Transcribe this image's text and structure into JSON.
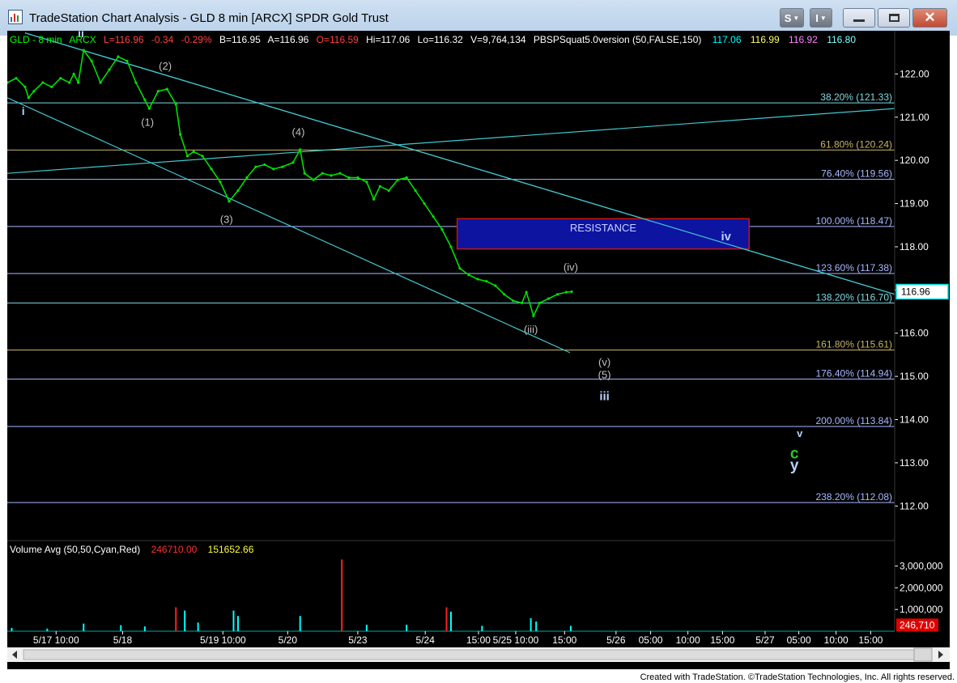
{
  "window": {
    "title": "TradeStation Chart Analysis - GLD 8 min [ARCX] SPDR Gold Trust",
    "btn_s": "S",
    "btn_i": "I",
    "footer": "Created with TradeStation. ©TradeStation Technologies, Inc. All rights reserved."
  },
  "colors": {
    "background": "#000000",
    "price": "#00e000",
    "channel": "#40c8d0",
    "fib_cyan": "#7fd8e0",
    "fib_olive": "#c8b46a",
    "fib_blue": "#a9b8ff",
    "resistance_fill": "#0d14a0",
    "resistance_border": "#c01616",
    "label_wave": "#c0c0c0",
    "label_green": "#22cc22",
    "label_blue": "#b8d0ff",
    "volume_cyan": "#00ffff",
    "volume_red": "#ff2020"
  },
  "header": {
    "symbol": "GLD - 8 min",
    "exchange": "ARCX",
    "last": "L=116.96",
    "change": "-0.34",
    "change_pct": "-0.29%",
    "bid": "B=116.95",
    "ask": "A=116.96",
    "open": "O=116.59",
    "high": "Hi=117.06",
    "low": "Lo=116.32",
    "volume": "V=9,764,134",
    "indicator": "PBSPSquat5.0version (50,FALSE,150)",
    "ind_v1": "117.06",
    "ind_v2": "116.99",
    "ind_v3": "116.92",
    "ind_v4": "116.80"
  },
  "volume_header": {
    "label": "Volume Avg (50,50,Cyan,Red)",
    "v1": "246710.00",
    "v2": "151652.66"
  },
  "resistance_label": "RESISTANCE",
  "chart_data": {
    "type": "line",
    "symbol": "GLD",
    "interval": "8 min",
    "price_axis": {
      "range": [
        111.2,
        123.0
      ],
      "ticks": [
        "122.00",
        "121.00",
        "120.00",
        "119.00",
        "118.00",
        "117.00",
        "116.00",
        "115.00",
        "114.00",
        "113.00",
        "112.00"
      ],
      "tick_values": [
        122,
        121,
        120,
        119,
        118,
        117,
        116,
        115,
        114,
        113,
        112
      ],
      "last_price_label": "116.96",
      "last_price": 116.96
    },
    "volume_axis": {
      "range": [
        0,
        3500000
      ],
      "ticks": [
        "3,000,000",
        "2,000,000",
        "1,000,000"
      ],
      "tick_values": [
        3000000,
        2000000,
        1000000
      ],
      "last_label": "246,710",
      "last_value": 246710
    },
    "time_axis": {
      "range": [
        0,
        100
      ],
      "labels": [
        {
          "t": 5.5,
          "text": "5/17 10:00"
        },
        {
          "t": 13.0,
          "text": "5/18"
        },
        {
          "t": 24.3,
          "text": "5/19 10:00"
        },
        {
          "t": 31.6,
          "text": "5/20"
        },
        {
          "t": 39.5,
          "text": "5/23"
        },
        {
          "t": 47.1,
          "text": "5/24"
        },
        {
          "t": 53.1,
          "text": "15:00"
        },
        {
          "t": 57.3,
          "text": "5/25 10:00"
        },
        {
          "t": 62.8,
          "text": "15:00"
        },
        {
          "t": 68.6,
          "text": "5/26"
        },
        {
          "t": 72.5,
          "text": "05:00"
        },
        {
          "t": 76.7,
          "text": "10:00"
        },
        {
          "t": 80.6,
          "text": "15:00"
        },
        {
          "t": 85.4,
          "text": "5/27"
        },
        {
          "t": 89.2,
          "text": "05:00"
        },
        {
          "t": 93.4,
          "text": "10:00"
        },
        {
          "t": 97.3,
          "text": "15:00"
        }
      ]
    },
    "fib_levels": [
      {
        "label": "38.20% (121.33)",
        "value": 121.33,
        "color": "#7fd8e0"
      },
      {
        "label": "61.80% (120.24)",
        "value": 120.24,
        "color": "#c8b46a"
      },
      {
        "label": "76.40% (119.56)",
        "value": 119.56,
        "color": "#a9b8ff"
      },
      {
        "label": "100.00% (118.47)",
        "value": 118.47,
        "color": "#a9b8ff"
      },
      {
        "label": "123.60% (117.38)",
        "value": 117.38,
        "color": "#a9b8ff"
      },
      {
        "label": "138.20% (116.70)",
        "value": 116.7,
        "color": "#7fd8e0"
      },
      {
        "label": "161.80% (115.61)",
        "value": 115.61,
        "color": "#c8b46a"
      },
      {
        "label": "176.40% (114.94)",
        "value": 114.94,
        "color": "#a9b8ff"
      },
      {
        "label": "200.00% (113.84)",
        "value": 113.84,
        "color": "#a9b8ff"
      },
      {
        "label": "238.20% (112.08)",
        "value": 112.08,
        "color": "#a9b8ff"
      }
    ],
    "trendlines": [
      {
        "from": [
          2.0,
          122.95
        ],
        "to": [
          100.0,
          116.9
        ]
      },
      {
        "from": [
          0.0,
          121.45
        ],
        "to": [
          63.4,
          115.55
        ]
      },
      {
        "from": [
          0.0,
          119.7
        ],
        "to": [
          100.0,
          121.2
        ]
      }
    ],
    "resistance_box": {
      "t_range": [
        50.7,
        83.6
      ],
      "price_range": [
        117.95,
        118.65
      ]
    },
    "price_series": [
      {
        "t": 0.0,
        "v": 121.8
      },
      {
        "t": 1.0,
        "v": 121.9
      },
      {
        "t": 2.0,
        "v": 121.7
      },
      {
        "t": 2.4,
        "v": 121.45
      },
      {
        "t": 3.0,
        "v": 121.6
      },
      {
        "t": 4.0,
        "v": 121.8
      },
      {
        "t": 5.0,
        "v": 121.7
      },
      {
        "t": 6.0,
        "v": 121.9
      },
      {
        "t": 7.0,
        "v": 121.8
      },
      {
        "t": 7.5,
        "v": 122.0
      },
      {
        "t": 8.0,
        "v": 121.8
      },
      {
        "t": 8.6,
        "v": 122.55
      },
      {
        "t": 9.5,
        "v": 122.3
      },
      {
        "t": 10.5,
        "v": 121.8
      },
      {
        "t": 11.5,
        "v": 122.1
      },
      {
        "t": 12.5,
        "v": 122.4
      },
      {
        "t": 13.5,
        "v": 122.3
      },
      {
        "t": 14.5,
        "v": 121.8
      },
      {
        "t": 15.5,
        "v": 121.4
      },
      {
        "t": 16.0,
        "v": 121.2
      },
      {
        "t": 17.0,
        "v": 121.6
      },
      {
        "t": 18.0,
        "v": 121.65
      },
      {
        "t": 19.0,
        "v": 121.3
      },
      {
        "t": 19.5,
        "v": 120.6
      },
      {
        "t": 20.3,
        "v": 120.1
      },
      {
        "t": 21.0,
        "v": 120.2
      },
      {
        "t": 22.0,
        "v": 120.1
      },
      {
        "t": 23.0,
        "v": 119.8
      },
      {
        "t": 24.0,
        "v": 119.5
      },
      {
        "t": 25.0,
        "v": 119.05
      },
      {
        "t": 26.0,
        "v": 119.3
      },
      {
        "t": 27.0,
        "v": 119.6
      },
      {
        "t": 28.0,
        "v": 119.85
      },
      {
        "t": 29.0,
        "v": 119.9
      },
      {
        "t": 30.0,
        "v": 119.8
      },
      {
        "t": 31.0,
        "v": 119.85
      },
      {
        "t": 32.2,
        "v": 119.95
      },
      {
        "t": 33.0,
        "v": 120.25
      },
      {
        "t": 33.5,
        "v": 119.7
      },
      {
        "t": 34.5,
        "v": 119.55
      },
      {
        "t": 35.5,
        "v": 119.7
      },
      {
        "t": 36.5,
        "v": 119.65
      },
      {
        "t": 37.5,
        "v": 119.7
      },
      {
        "t": 38.5,
        "v": 119.6
      },
      {
        "t": 39.5,
        "v": 119.6
      },
      {
        "t": 40.5,
        "v": 119.5
      },
      {
        "t": 41.3,
        "v": 119.1
      },
      {
        "t": 42.0,
        "v": 119.4
      },
      {
        "t": 43.0,
        "v": 119.3
      },
      {
        "t": 44.0,
        "v": 119.55
      },
      {
        "t": 45.0,
        "v": 119.6
      },
      {
        "t": 46.0,
        "v": 119.3
      },
      {
        "t": 47.0,
        "v": 119.0
      },
      {
        "t": 48.0,
        "v": 118.7
      },
      {
        "t": 49.0,
        "v": 118.4
      },
      {
        "t": 50.0,
        "v": 118.0
      },
      {
        "t": 51.0,
        "v": 117.5
      },
      {
        "t": 52.0,
        "v": 117.35
      },
      {
        "t": 53.0,
        "v": 117.25
      },
      {
        "t": 54.0,
        "v": 117.2
      },
      {
        "t": 55.0,
        "v": 117.1
      },
      {
        "t": 56.0,
        "v": 116.9
      },
      {
        "t": 57.0,
        "v": 116.75
      },
      {
        "t": 58.0,
        "v": 116.7
      },
      {
        "t": 58.5,
        "v": 116.95
      },
      {
        "t": 59.3,
        "v": 116.4
      },
      {
        "t": 60.0,
        "v": 116.7
      },
      {
        "t": 61.0,
        "v": 116.8
      },
      {
        "t": 62.0,
        "v": 116.9
      },
      {
        "t": 63.0,
        "v": 116.95
      },
      {
        "t": 63.6,
        "v": 116.96
      }
    ],
    "volume_series": [
      {
        "t": 0.5,
        "v": 150000
      },
      {
        "t": 4.5,
        "v": 120000
      },
      {
        "t": 8.6,
        "v": 350000
      },
      {
        "t": 12.8,
        "v": 280000
      },
      {
        "t": 15.5,
        "v": 220000
      },
      {
        "t": 19.0,
        "v": 1100000
      },
      {
        "t": 20.0,
        "v": 950000
      },
      {
        "t": 21.5,
        "v": 400000
      },
      {
        "t": 25.5,
        "v": 950000
      },
      {
        "t": 26.0,
        "v": 700000
      },
      {
        "t": 33.0,
        "v": 700000
      },
      {
        "t": 37.7,
        "v": 3300000
      },
      {
        "t": 40.5,
        "v": 300000
      },
      {
        "t": 45.0,
        "v": 300000
      },
      {
        "t": 49.5,
        "v": 1100000
      },
      {
        "t": 50.0,
        "v": 900000
      },
      {
        "t": 53.5,
        "v": 250000
      },
      {
        "t": 59.0,
        "v": 600000
      },
      {
        "t": 59.6,
        "v": 450000
      },
      {
        "t": 63.5,
        "v": 246710
      }
    ],
    "wave_labels": [
      {
        "text": "ii",
        "t": 8.3,
        "p": 122.85,
        "color": "#b8d0ff",
        "size": 14,
        "bold": true
      },
      {
        "text": "i",
        "t": 1.8,
        "p": 121.05,
        "color": "#b8d0ff",
        "size": 14,
        "bold": true
      },
      {
        "text": "(2)",
        "t": 17.8,
        "p": 122.1,
        "color": "#c0c0c0",
        "size": 13,
        "bold": false
      },
      {
        "text": "(1)",
        "t": 15.8,
        "p": 120.8,
        "color": "#c0c0c0",
        "size": 13,
        "bold": false
      },
      {
        "text": "(4)",
        "t": 32.8,
        "p": 120.57,
        "color": "#c0c0c0",
        "size": 13,
        "bold": false
      },
      {
        "text": "(3)",
        "t": 24.7,
        "p": 118.55,
        "color": "#c0c0c0",
        "size": 13,
        "bold": false
      },
      {
        "text": "(iv)",
        "t": 63.5,
        "p": 117.45,
        "color": "#c0c0c0",
        "size": 13,
        "bold": false
      },
      {
        "text": "(iii)",
        "t": 59.0,
        "p": 116.0,
        "color": "#c0c0c0",
        "size": 13,
        "bold": false
      },
      {
        "text": "(v)",
        "t": 67.3,
        "p": 115.25,
        "color": "#c0c0c0",
        "size": 13,
        "bold": false
      },
      {
        "text": "(5)",
        "t": 67.3,
        "p": 114.96,
        "color": "#c0c0c0",
        "size": 13,
        "bold": false
      },
      {
        "text": "iii",
        "t": 67.3,
        "p": 114.45,
        "color": "#b8d0ff",
        "size": 15,
        "bold": true
      },
      {
        "text": "iv",
        "t": 81.0,
        "p": 118.15,
        "color": "#b8d0ff",
        "size": 15,
        "bold": true
      },
      {
        "text": "v",
        "t": 89.3,
        "p": 113.6,
        "color": "#b8d0ff",
        "size": 13,
        "bold": true
      },
      {
        "text": "c",
        "t": 88.7,
        "p": 113.1,
        "color": "#22cc22",
        "size": 19,
        "bold": true
      },
      {
        "text": "y",
        "t": 88.7,
        "p": 112.83,
        "color": "#b8d0ff",
        "size": 19,
        "bold": true
      }
    ]
  }
}
